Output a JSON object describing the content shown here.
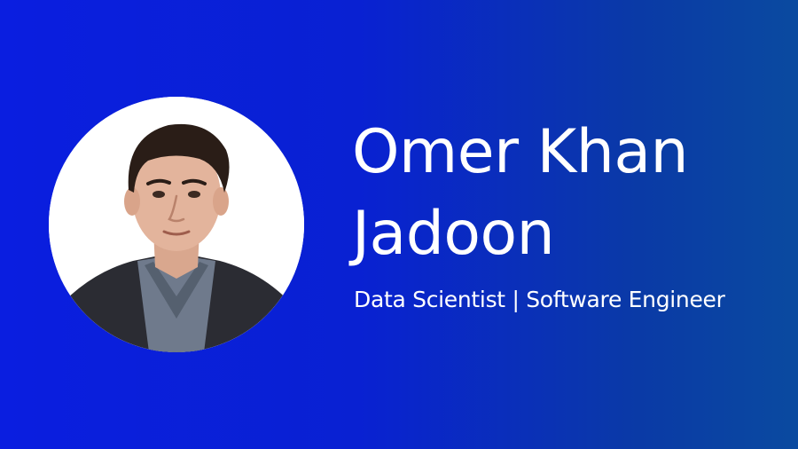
{
  "profile": {
    "name_line1": "Omer Khan",
    "name_line2": "Jadoon",
    "subtitle": "Data Scientist | Software Engineer"
  },
  "colors": {
    "background_left": "#0a1ee0",
    "background_right": "#0a4aa0",
    "text": "#ffffff",
    "photo_background": "#ffffff"
  }
}
